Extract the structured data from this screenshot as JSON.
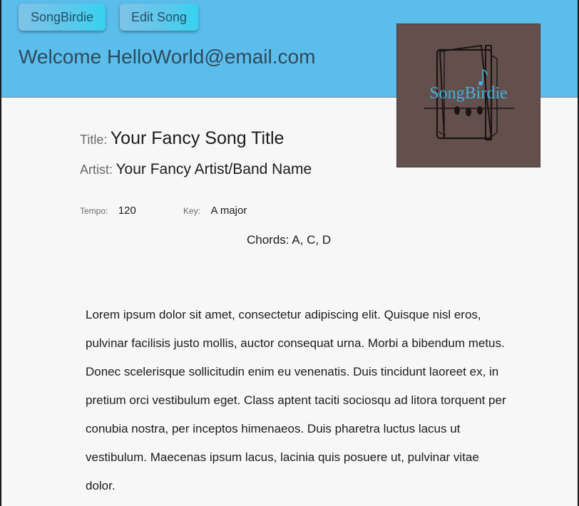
{
  "nav": {
    "home_label": "SongBirdie",
    "edit_label": "Edit Song"
  },
  "header": {
    "welcome_text": "Welcome HelloWorld@email.com",
    "logo_text": "SongBirdie"
  },
  "song": {
    "title_label": "Title:",
    "title": "Your Fancy Song Title",
    "artist_label": "Artist:",
    "artist": "Your Fancy Artist/Band Name",
    "tempo_label": "Tempo:",
    "tempo": "120",
    "key_label": "Key:",
    "key": "A major",
    "chords": "Chords: A, C, D",
    "lyrics": "Lorem ipsum dolor sit amet, consectetur adipiscing elit. Quisque nisl eros, pulvinar facilisis justo mollis, auctor consequat urna. Morbi a bibendum metus. Donec scelerisque sollicitudin enim eu venenatis. Duis tincidunt laoreet ex, in pretium orci vestibulum eget. Class aptent taciti sociosqu ad litora torquent per conubia nostra, per inceptos himenaeos. Duis pharetra luctus lacus ut vestibulum. Maecenas ipsum lacus, lacinia quis posuere ut, pulvinar vitae dolor."
  },
  "colors": {
    "header_bg": "#5bbdec",
    "logo_bg": "#634f4c",
    "logo_text": "#3fb3e0",
    "page_bg": "#f7f7f7"
  }
}
